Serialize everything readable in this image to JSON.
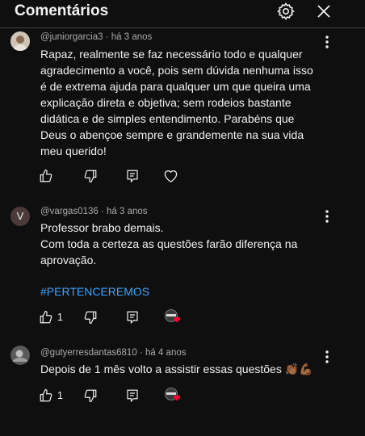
{
  "header": {
    "title": "Comentários",
    "icons": [
      "gear-icon",
      "close-icon"
    ]
  },
  "comments": [
    {
      "author": "@juniorgarcia3",
      "time": "há 3 anos",
      "lines": [
        "Rapaz, realmente se faz necessário todo e qualquer",
        "agradecimento a você, pois sem dúvida nenhuma isso",
        "é de extrema ajuda para qualquer um que queira uma",
        "explicação direta e objetiva; sem rodeios bastante",
        "didática e de simples entendimento. Parabéns que",
        "Deus o abençoe sempre e grandemente na sua vida",
        "meu querido!"
      ],
      "likes": ""
    },
    {
      "author": "@vargas0136",
      "time": "há 3 anos",
      "avatar_letter": "V",
      "lines": [
        "Professor brabo demais.",
        "Com toda a certeza as questões farão diferença na",
        "aprovação."
      ],
      "hashtag": "#PERTENCEREMOS",
      "likes": "1"
    },
    {
      "author": "@gutyerresdantas6810",
      "time": "há 4 anos",
      "lines": [
        "Depois de 1 mês volto a assistir essas questões 👏🏾💪🏾"
      ],
      "likes": "1"
    }
  ],
  "colors": {
    "background": "#0f0f0f",
    "text": "#f1f1f1",
    "meta": "#aaaaaa",
    "hashtag": "#3ea6ff",
    "heart": "#ff0033"
  }
}
